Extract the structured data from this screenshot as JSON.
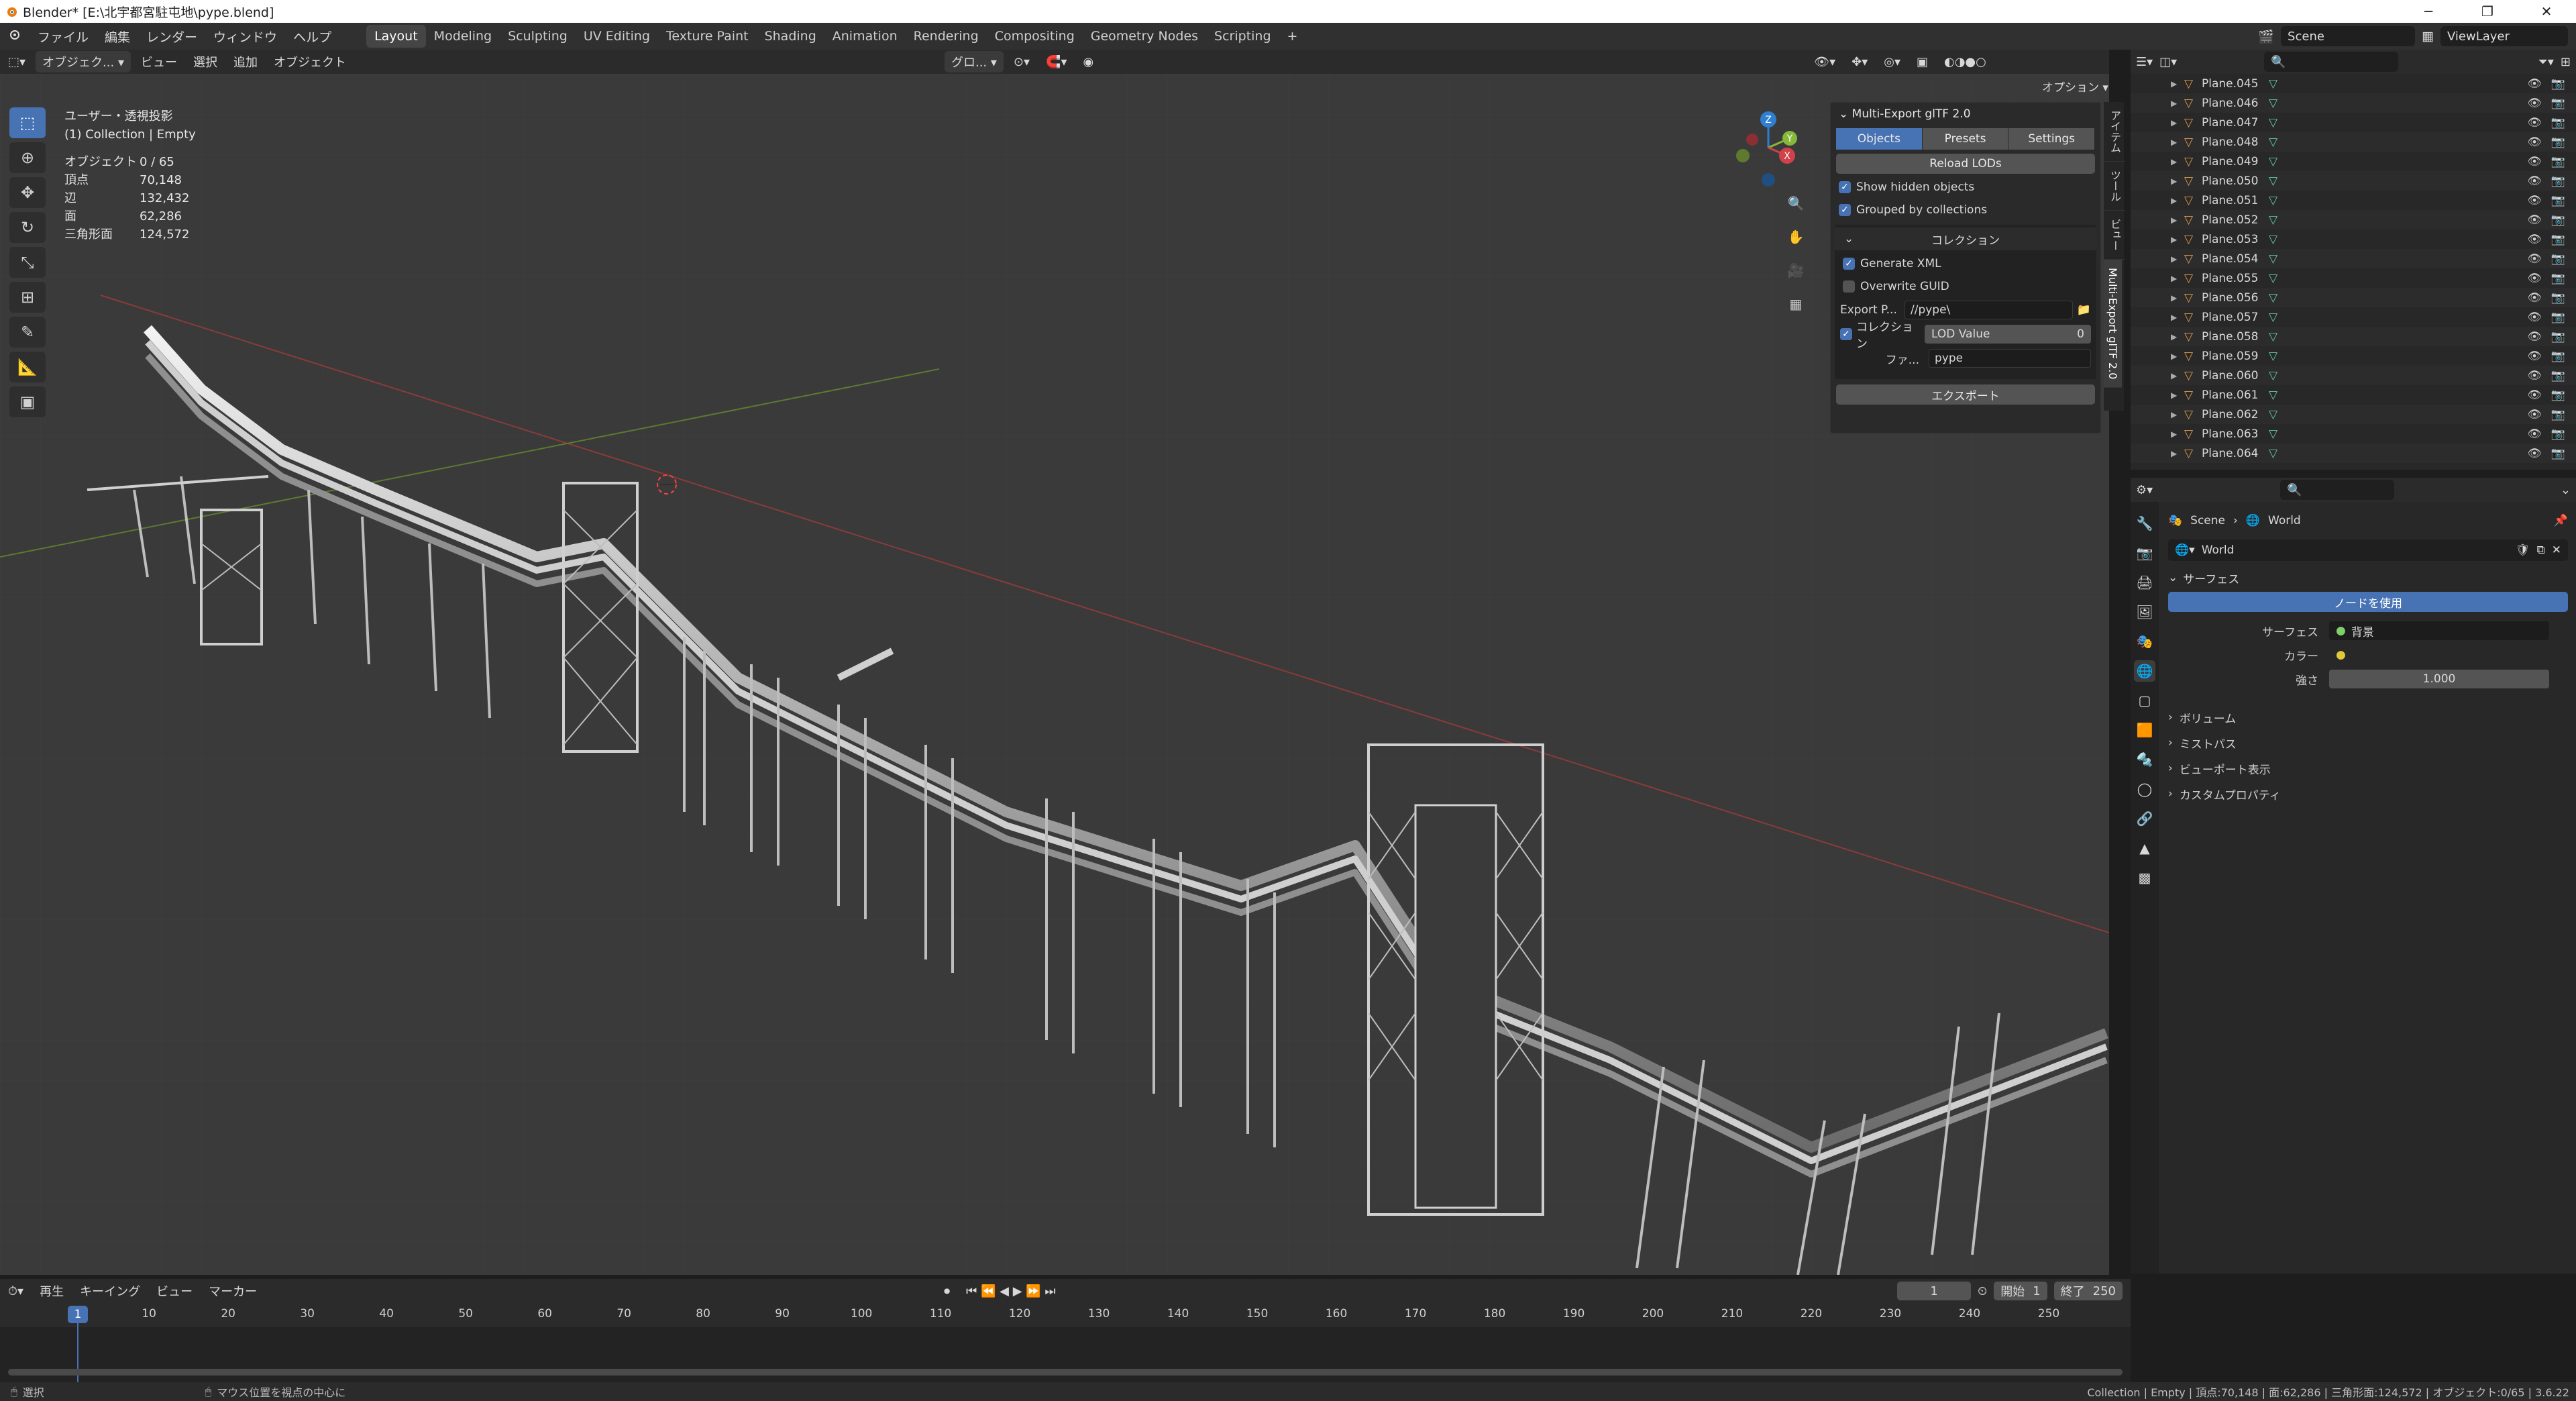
{
  "window": {
    "title": "Blender* [E:\\北宇都宮駐屯地\\pype.blend]",
    "controls": [
      "─",
      "❐",
      "✕"
    ]
  },
  "menu": {
    "items": [
      "ファイル",
      "編集",
      "レンダー",
      "ウィンドウ",
      "ヘルプ"
    ],
    "workspaces": [
      "Layout",
      "Modeling",
      "Sculpting",
      "UV Editing",
      "Texture Paint",
      "Shading",
      "Animation",
      "Rendering",
      "Compositing",
      "Geometry Nodes",
      "Scripting"
    ],
    "active_workspace": "Layout",
    "add_tab": "+",
    "scene": "Scene",
    "view_layer": "ViewLayer"
  },
  "viewport_header": {
    "mode": "オブジェク...",
    "menus": [
      "ビュー",
      "選択",
      "追加",
      "オブジェクト"
    ],
    "transform_orientation": "グロ...",
    "options": "オプション"
  },
  "overlay": {
    "view_name": "ユーザー・透視投影",
    "collection": "(1) Collection | Empty",
    "stats": [
      {
        "label": "オブジェクト",
        "value": "0 / 65"
      },
      {
        "label": "頂点",
        "value": "70,148"
      },
      {
        "label": "辺",
        "value": "132,432"
      },
      {
        "label": "面",
        "value": "62,286"
      },
      {
        "label": "三角形面",
        "value": "124,572"
      }
    ]
  },
  "gizmo": {
    "x": "X",
    "y": "Y",
    "z": "Z"
  },
  "npanel": {
    "title": "Multi-Export glTF 2.0",
    "tabs": [
      "Objects",
      "Presets",
      "Settings"
    ],
    "active_tab": "Objects",
    "reload_label": "Reload LODs",
    "show_hidden": "Show hidden objects",
    "grouped": "Grouped by collections",
    "collection_header": "コレクション",
    "generate_xml": "Generate XML",
    "overwrite_guid": "Overwrite GUID",
    "export_path_label": "Export P...",
    "export_path_value": "//pype\\",
    "collection_check": "コレクション",
    "lod_label": "LOD Value",
    "lod_value": "0",
    "file_label": "ファ...",
    "file_value": "pype",
    "export_button": "エクスポート",
    "side_tabs": [
      "アイテム",
      "ツール",
      "ビュー",
      "Multi-Export glTF 2.0"
    ]
  },
  "outliner": {
    "rows": [
      "Plane.045",
      "Plane.046",
      "Plane.047",
      "Plane.048",
      "Plane.049",
      "Plane.050",
      "Plane.051",
      "Plane.052",
      "Plane.053",
      "Plane.054",
      "Plane.055",
      "Plane.056",
      "Plane.057",
      "Plane.058",
      "Plane.059",
      "Plane.060",
      "Plane.061",
      "Plane.062",
      "Plane.063",
      "Plane.064"
    ]
  },
  "properties": {
    "breadcrumb": [
      "Scene",
      "World"
    ],
    "world_name": "World",
    "surface_header": "サーフェス",
    "use_nodes": "ノードを使用",
    "surface_label": "サーフェス",
    "surface_value": "背景",
    "color_label": "カラー",
    "strength_label": "強さ",
    "strength_value": "1.000",
    "collapsed_panels": [
      "ボリューム",
      "ミストパス",
      "ビューポート表示",
      "カスタムプロパティ"
    ]
  },
  "timeline": {
    "menus": [
      "再生",
      "キーイング",
      "ビュー",
      "マーカー"
    ],
    "current_frame": "1",
    "start_label": "開始",
    "start_value": "1",
    "end_label": "終了",
    "end_value": "250",
    "ticks": [
      "10",
      "20",
      "30",
      "40",
      "50",
      "60",
      "70",
      "80",
      "90",
      "100",
      "110",
      "120",
      "130",
      "140",
      "150",
      "160",
      "170",
      "180",
      "190",
      "200",
      "210",
      "220",
      "230",
      "240",
      "250"
    ],
    "playhead_label": "1"
  },
  "status": {
    "left": "選択",
    "middle": "マウス位置を視点の中心に",
    "right": "Collection | Empty | 頂点:70,148 | 面:62,286 | 三角形面:124,572 | オブジェクト:0/65 | 3.6.22"
  }
}
